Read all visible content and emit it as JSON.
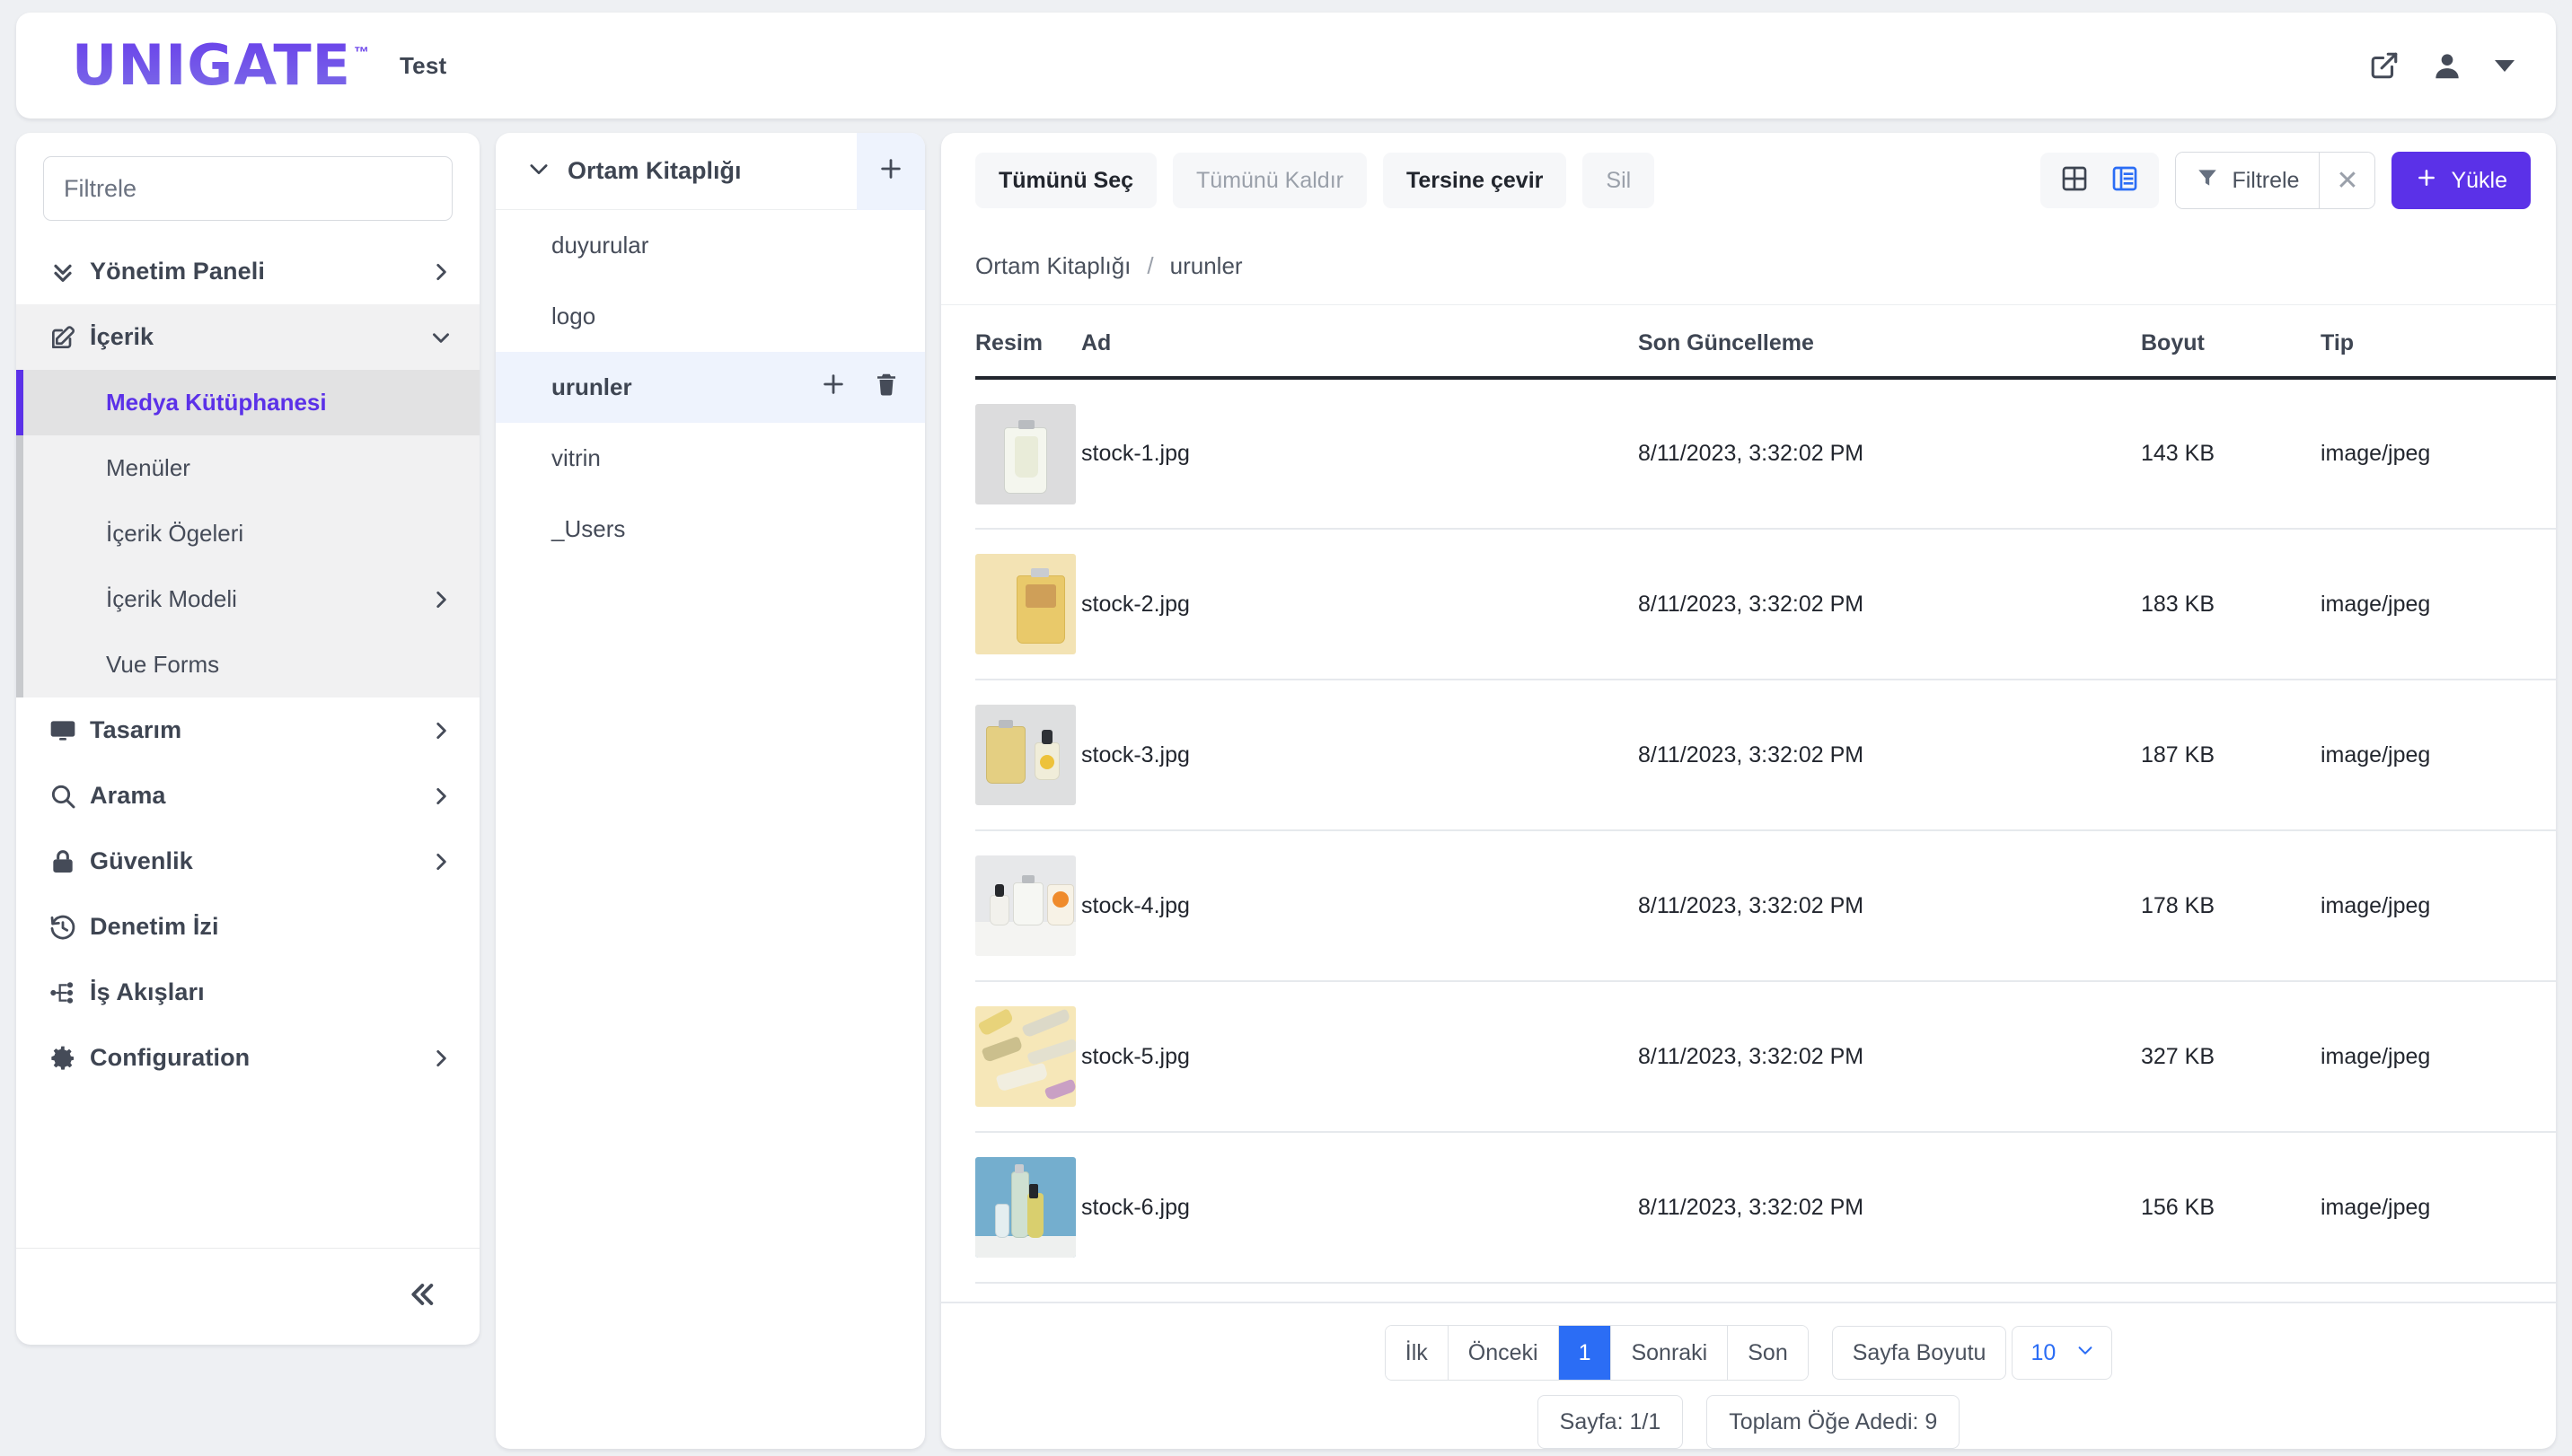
{
  "topbar": {
    "logo_text": "UNIGATE",
    "logo_tm": "™",
    "env_label": "Test",
    "external_link_icon": "external-link-icon",
    "user_icon": "user-icon",
    "caret_icon": "chevron-down-icon"
  },
  "sidebar": {
    "filter_placeholder": "Filtrele",
    "items": [
      {
        "label": "Yönetim Paneli",
        "icon": "double-chevron-down-icon",
        "chevron": "right"
      },
      {
        "label": "İçerik",
        "icon": "edit-pencil-icon",
        "chevron": "down",
        "expanded": true
      },
      {
        "label": "Tasarım",
        "icon": "monitor-icon",
        "chevron": "right"
      },
      {
        "label": "Arama",
        "icon": "search-icon",
        "chevron": "right"
      },
      {
        "label": "Güvenlik",
        "icon": "lock-icon",
        "chevron": "right"
      },
      {
        "label": "Denetim İzi",
        "icon": "history-icon",
        "chevron": "none"
      },
      {
        "label": "İş Akışları",
        "icon": "sitemap-icon",
        "chevron": "none"
      },
      {
        "label": "Configuration",
        "icon": "gear-icon",
        "chevron": "right"
      }
    ],
    "sub_items": [
      {
        "label": "Medya Kütüphanesi",
        "active": true,
        "chevron": "none"
      },
      {
        "label": "Menüler",
        "active": false,
        "chevron": "none"
      },
      {
        "label": "İçerik Ögeleri",
        "active": false,
        "chevron": "none"
      },
      {
        "label": "İçerik Modeli",
        "active": false,
        "chevron": "right"
      },
      {
        "label": "Vue Forms",
        "active": false,
        "chevron": "none"
      }
    ],
    "collapse_icon": "double-chevron-left-icon"
  },
  "tree": {
    "title": "Ortam Kitaplığı",
    "toggle_icon": "chevron-down-icon",
    "add_icon": "plus-icon",
    "items": [
      {
        "label": "duyurular",
        "selected": false
      },
      {
        "label": "logo",
        "selected": false
      },
      {
        "label": "urunler",
        "selected": true,
        "add_icon": "plus-icon",
        "delete_icon": "trash-icon"
      },
      {
        "label": "vitrin",
        "selected": false
      },
      {
        "label": "_Users",
        "selected": false
      }
    ]
  },
  "toolbar": {
    "select_all": "Tümünü Seç",
    "deselect_all": "Tümünü Kaldır",
    "invert": "Tersine çevir",
    "delete": "Sil",
    "grid_view_icon": "grid-view-icon",
    "list_view_icon": "list-view-icon",
    "filter_label": "Filtrele",
    "filter_icon": "funnel-icon",
    "filter_clear_icon": "close-icon",
    "upload_label": "Yükle",
    "upload_icon": "plus-icon"
  },
  "breadcrumb": {
    "root": "Ortam Kitaplığı",
    "separator": "/",
    "current": "urunler"
  },
  "table": {
    "columns": [
      "Resim",
      "Ad",
      "Son Güncelleme",
      "Boyut",
      "Tip"
    ],
    "rows": [
      {
        "name": "stock-1.jpg",
        "updated": "8/11/2023, 3:32:02 PM",
        "size": "143 KB",
        "type": "image/jpeg"
      },
      {
        "name": "stock-2.jpg",
        "updated": "8/11/2023, 3:32:02 PM",
        "size": "183 KB",
        "type": "image/jpeg"
      },
      {
        "name": "stock-3.jpg",
        "updated": "8/11/2023, 3:32:02 PM",
        "size": "187 KB",
        "type": "image/jpeg"
      },
      {
        "name": "stock-4.jpg",
        "updated": "8/11/2023, 3:32:02 PM",
        "size": "178 KB",
        "type": "image/jpeg"
      },
      {
        "name": "stock-5.jpg",
        "updated": "8/11/2023, 3:32:02 PM",
        "size": "327 KB",
        "type": "image/jpeg"
      },
      {
        "name": "stock-6.jpg",
        "updated": "8/11/2023, 3:32:02 PM",
        "size": "156 KB",
        "type": "image/jpeg"
      }
    ]
  },
  "pagination": {
    "first": "İlk",
    "prev": "Önceki",
    "current_page": "1",
    "next": "Sonraki",
    "last": "Son",
    "page_size_label": "Sayfa Boyutu",
    "page_size_value": "10",
    "page_info": "Sayfa: 1/1",
    "total_info": "Toplam Öğe Adedi: 9"
  },
  "colors": {
    "accent_purple": "#5b31e8",
    "accent_blue": "#2b6df5",
    "page_bg": "#eef0f3",
    "text_dark": "#3e4552"
  }
}
